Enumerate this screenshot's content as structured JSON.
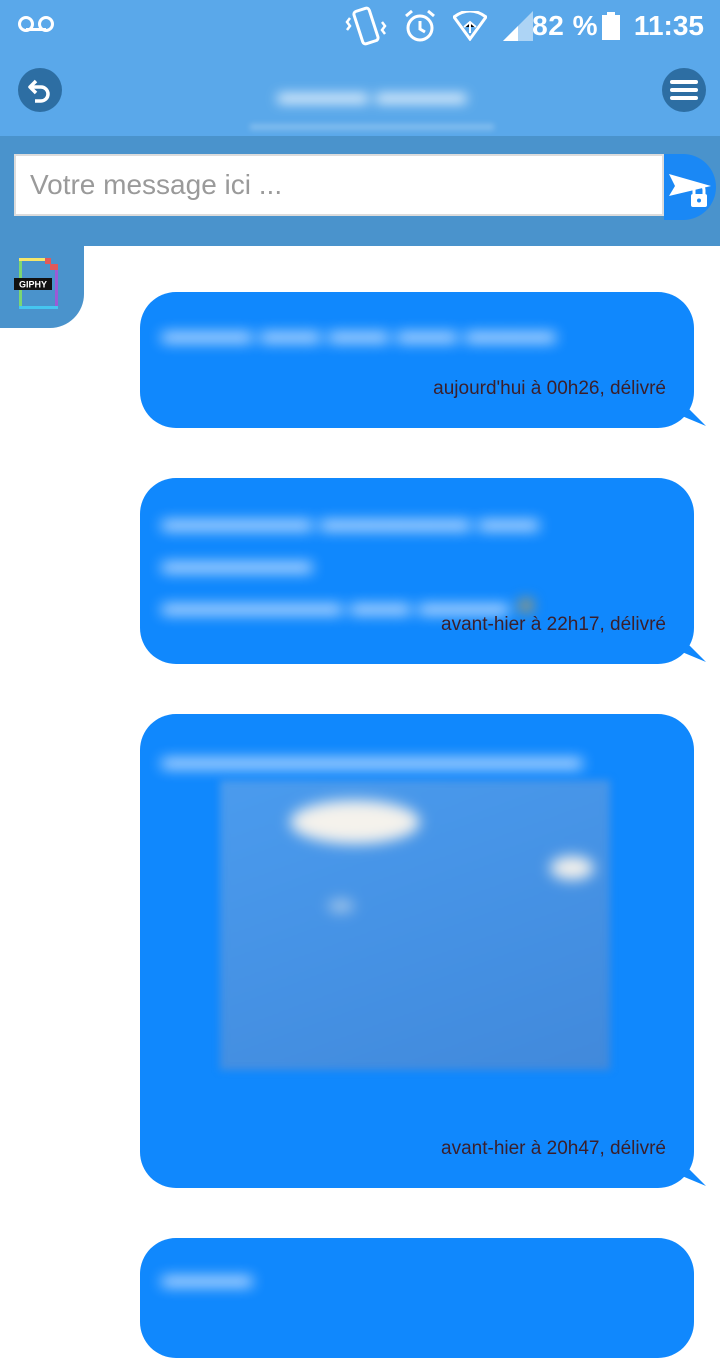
{
  "status_bar": {
    "battery_percent": "82 %",
    "time": "11:35",
    "icons": [
      "voicemail-icon",
      "vibrate-icon",
      "alarm-icon",
      "wifi-icon",
      "signal-icon",
      "battery-icon"
    ]
  },
  "header": {
    "icons": [
      "back-icon",
      "menu-icon"
    ]
  },
  "composer": {
    "placeholder": "Votre message ici ...",
    "send_icon": "send-secure-icon"
  },
  "giphy": {
    "label": "GIPHY"
  },
  "messages": [
    {
      "meta": "aujourd'hui à 00h26, délivré"
    },
    {
      "meta": "avant-hier à 22h17, délivré"
    },
    {
      "meta": "avant-hier à 20h47, délivré"
    }
  ],
  "colors": {
    "header": "#5aa8ea",
    "composer": "#4a93cc",
    "bubble": "#1088fd",
    "meta_text": "#3b1f2b"
  }
}
